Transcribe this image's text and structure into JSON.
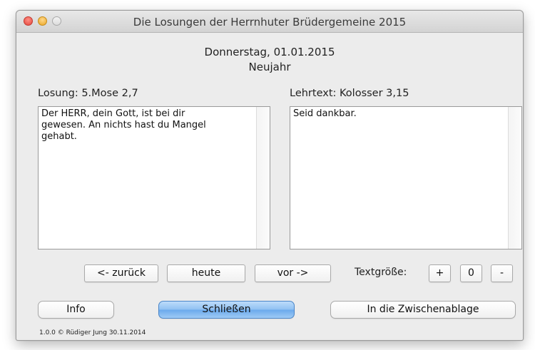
{
  "window": {
    "title": "Die Losungen der Herrnhuter Brüdergemeine 2015"
  },
  "header": {
    "date": "Donnerstag, 01.01.2015",
    "holiday": "Neujahr"
  },
  "losung": {
    "label": "Losung: 5.Mose 2,7",
    "text": "Der HERR, dein Gott, ist bei dir\ngewesen. An nichts hast du Mangel\ngehabt."
  },
  "lehrtext": {
    "label": "Lehrtext: Kolosser 3,15",
    "text": "Seid dankbar."
  },
  "nav": {
    "back_label": "<- zurück",
    "today_label": "heute",
    "next_label": "vor ->"
  },
  "textsize": {
    "label": "Textgröße:",
    "plus_label": "+",
    "value": "0",
    "minus_label": "-"
  },
  "actions": {
    "info_label": "Info",
    "close_label": "Schließen",
    "clipboard_label": "In die Zwischenablage"
  },
  "footer": {
    "version": "1.0.0 © Rüdiger Jung 30.11.2014"
  },
  "colors": {
    "default_button": "#8fc0f2",
    "window_bg": "#ececec"
  }
}
